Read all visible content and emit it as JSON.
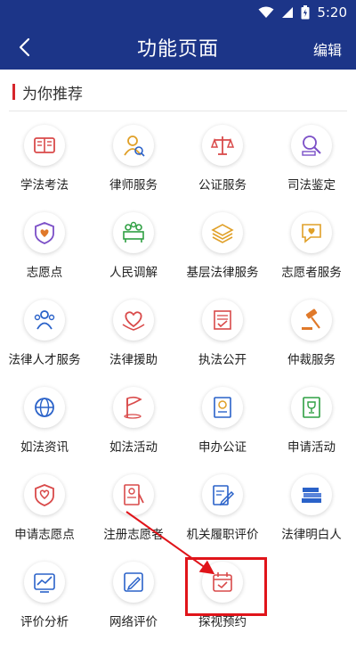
{
  "status_bar": {
    "time": "5:20"
  },
  "header": {
    "title": "功能页面",
    "edit_label": "编辑"
  },
  "section": {
    "title": "为你推荐"
  },
  "items": [
    {
      "label": "学法考法",
      "icon": "book-icon",
      "color": "#d94a4a"
    },
    {
      "label": "律师服务",
      "icon": "lawyer-icon",
      "color": "#e0a028"
    },
    {
      "label": "公证服务",
      "icon": "scales-icon",
      "color": "#d94a4a"
    },
    {
      "label": "司法鉴定",
      "icon": "forensic-icon",
      "color": "#7b4fc7"
    },
    {
      "label": "志愿点",
      "icon": "volunteer-point-icon",
      "color": "#7b4fc7"
    },
    {
      "label": "人民调解",
      "icon": "mediation-icon",
      "color": "#2fa043"
    },
    {
      "label": "基层法律服务",
      "icon": "documents-icon",
      "color": "#e0a028"
    },
    {
      "label": "志愿者服务",
      "icon": "heart-chat-icon",
      "color": "#e0a028"
    },
    {
      "label": "法律人才服务",
      "icon": "people-icon",
      "color": "#2a62c9"
    },
    {
      "label": "法律援助",
      "icon": "heart-hands-icon",
      "color": "#d94a4a"
    },
    {
      "label": "执法公开",
      "icon": "inspection-icon",
      "color": "#d94a4a"
    },
    {
      "label": "仲裁服务",
      "icon": "gavel-icon",
      "color": "#e0792a"
    },
    {
      "label": "如法资讯",
      "icon": "globe-icon",
      "color": "#2a62c9"
    },
    {
      "label": "如法活动",
      "icon": "flag-icon",
      "color": "#d94a4a"
    },
    {
      "label": "申办公证",
      "icon": "certificate-icon",
      "color": "#2a62c9"
    },
    {
      "label": "申请活动",
      "icon": "trophy-doc-icon",
      "color": "#2fa043"
    },
    {
      "label": "申请志愿点",
      "icon": "volunteer-apply-icon",
      "color": "#d94a4a"
    },
    {
      "label": "注册志愿者",
      "icon": "register-icon",
      "color": "#d94a4a"
    },
    {
      "label": "机关履职评价",
      "icon": "edit-doc-icon",
      "color": "#2a62c9"
    },
    {
      "label": "法律明白人",
      "icon": "books-stack-icon",
      "color": "#2a62c9"
    },
    {
      "label": "评价分析",
      "icon": "analytics-icon",
      "color": "#2a62c9"
    },
    {
      "label": "网络评价",
      "icon": "review-icon",
      "color": "#2a62c9"
    },
    {
      "label": "探视预约",
      "icon": "calendar-check-icon",
      "color": "#d94a4a"
    }
  ]
}
